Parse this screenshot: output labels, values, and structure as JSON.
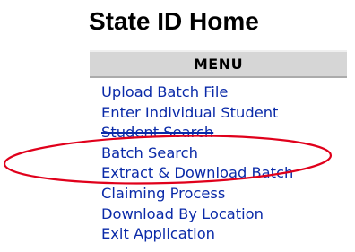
{
  "page": {
    "title": "State ID Home"
  },
  "menu": {
    "header": "MENU",
    "items": [
      {
        "label": "Upload Batch File"
      },
      {
        "label": "Enter Individual Student"
      },
      {
        "label": "Student Search"
      },
      {
        "label": "Batch Search"
      },
      {
        "label": "Extract & Download Batch"
      },
      {
        "label": "Claiming Process"
      },
      {
        "label": "Download By Location"
      },
      {
        "label": "Exit Application"
      }
    ]
  },
  "annotation": {
    "shape": "ellipse",
    "color": "#e0001b",
    "highlights": "Batch Search"
  }
}
